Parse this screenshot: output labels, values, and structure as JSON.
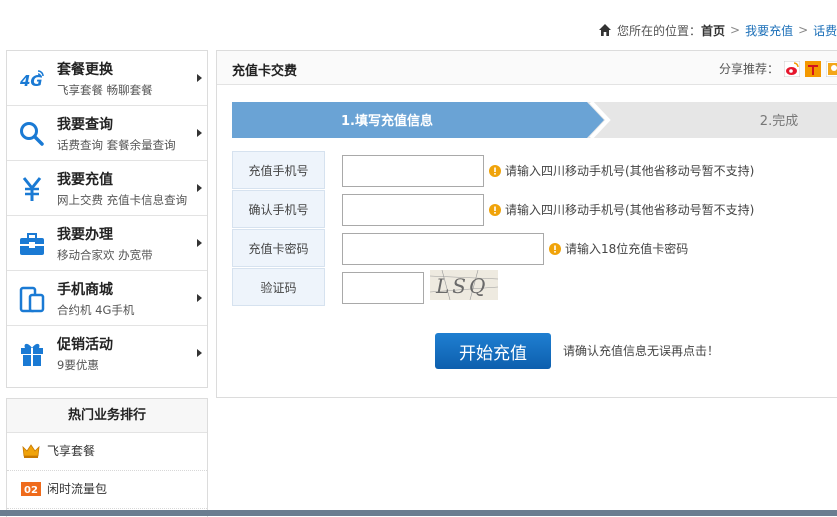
{
  "breadcrumb": {
    "prefix": "您所在的位置：",
    "home": "首页",
    "separator": ">",
    "level1": "我要充值",
    "level2": "话费充"
  },
  "sidebar": {
    "items": [
      {
        "icon": "4g-icon",
        "title": "套餐更换",
        "subtitle": "飞享套餐 畅聊套餐"
      },
      {
        "icon": "search-icon",
        "title": "我要查询",
        "subtitle": "话费查询 套餐余量查询"
      },
      {
        "icon": "yuan-icon",
        "title": "我要充值",
        "subtitle": "网上交费 充值卡信息查询"
      },
      {
        "icon": "briefcase-icon",
        "title": "我要办理",
        "subtitle": "移动合家欢 办宽带"
      },
      {
        "icon": "phone-icon",
        "title": "手机商城",
        "subtitle": "合约机 4G手机"
      },
      {
        "icon": "gift-icon",
        "title": "促销活动",
        "subtitle": "9要优惠"
      }
    ]
  },
  "hot": {
    "title": "热门业务排行",
    "items": [
      {
        "rank_label": "",
        "label": "飞享套餐"
      },
      {
        "rank_label": "02",
        "label": "闲时流量包"
      }
    ]
  },
  "panel": {
    "title": "充值卡交费",
    "share_label": "分享推荐：",
    "share_icons": [
      "weibo-icon",
      "tencent-icon",
      "renren-icon"
    ]
  },
  "steps": {
    "step1": "1.填写充值信息",
    "step2": "2.完成",
    "active_color": "#6aa3d5",
    "inactive_color": "#e6e6e6"
  },
  "form": {
    "phone_label": "充值手机号",
    "phone_value": "",
    "phone_hint": "请输入四川移动手机号(其他省移动号暂不支持)",
    "confirm_label": "确认手机号",
    "confirm_value": "",
    "confirm_hint": "请输入四川移动手机号(其他省移动号暂不支持)",
    "card_label": "充值卡密码",
    "card_value": "",
    "card_hint": "请输入18位充值卡密码",
    "captcha_label": "验证码",
    "captcha_value": "",
    "captcha_image_text": "LSQ",
    "submit_label": "开始充值",
    "confirm_tip": "请确认充值信息无误再点击！"
  },
  "colors": {
    "link": "#1b6fb8",
    "brand_blue": "#1a7ad4",
    "warn": "#f0a30a",
    "button": "#0d5fae"
  }
}
